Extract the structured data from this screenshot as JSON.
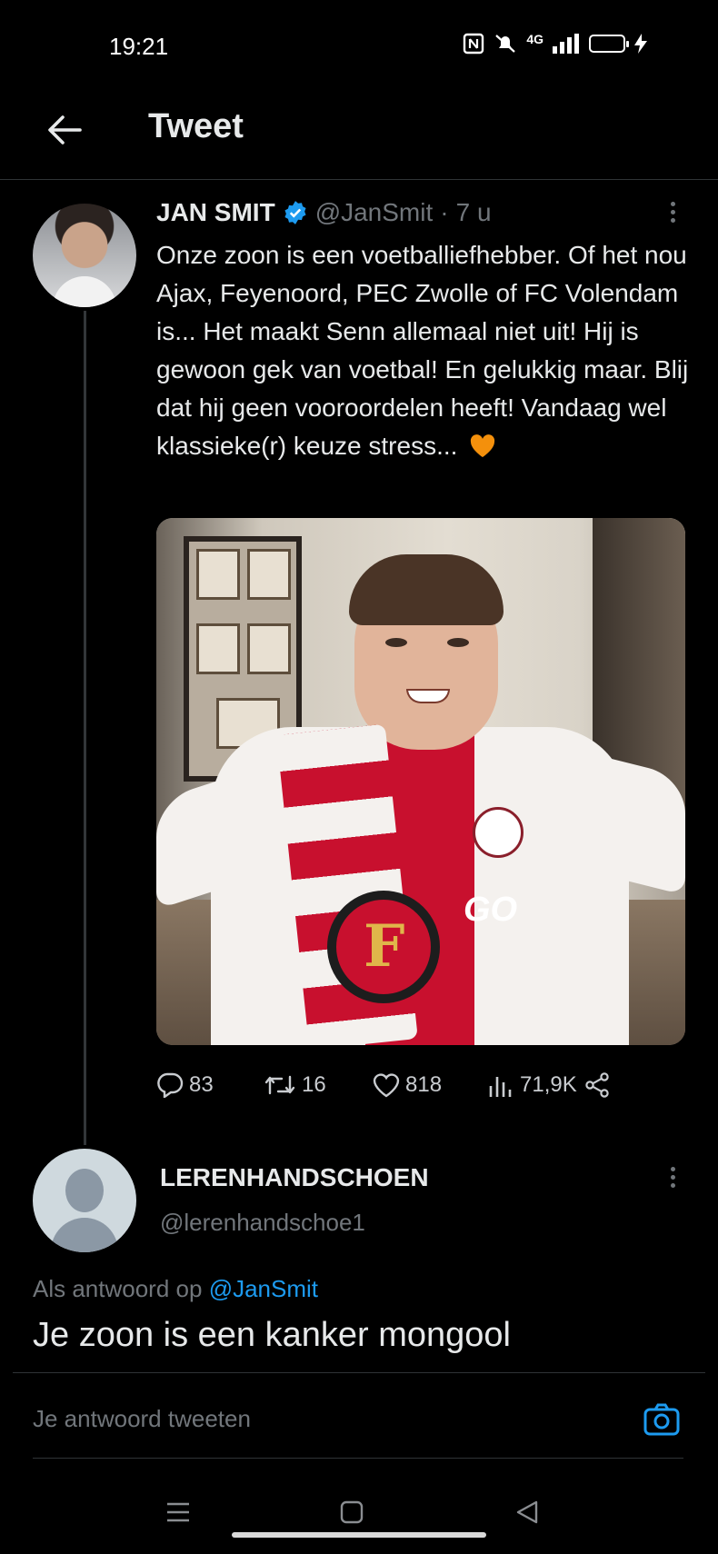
{
  "status_bar": {
    "time": "19:21",
    "network": "4G"
  },
  "header": {
    "title": "Tweet",
    "back_icon": "arrow-left-icon"
  },
  "tweet": {
    "author_name": "JAN SMIT",
    "handle": "@JanSmit",
    "separator": "·",
    "time_ago": "7 u",
    "text": "Onze zoon is een voetballiefhebber. Of het nou Ajax, Feyenoord, PEC Zwolle of FC Volendam is... Het maakt Senn allemaal niet uit! Hij is gewoon gek van voetbal! En gelukkig maar. Blij dat hij geen vooroordelen heeft! Vandaag wel klassieke(r) keuze stress...",
    "emoji": "orange-heart-icon",
    "photo_text": "GO",
    "stats": {
      "replies": "83",
      "retweets": "16",
      "likes": "818",
      "views": "71,9K"
    }
  },
  "reply": {
    "author_name": "LERENHANDSCHOEN",
    "handle": "@lerenhandschoe1",
    "context_prefix": "Als antwoord op",
    "context_mention": "@JanSmit",
    "text": "Je zoon is een kanker mongool"
  },
  "composer": {
    "placeholder": "Je antwoord tweeten"
  },
  "colors": {
    "background": "#000000",
    "accent": "#1d9bf0",
    "secondary_text": "#71767b",
    "divider": "#2f3336"
  }
}
